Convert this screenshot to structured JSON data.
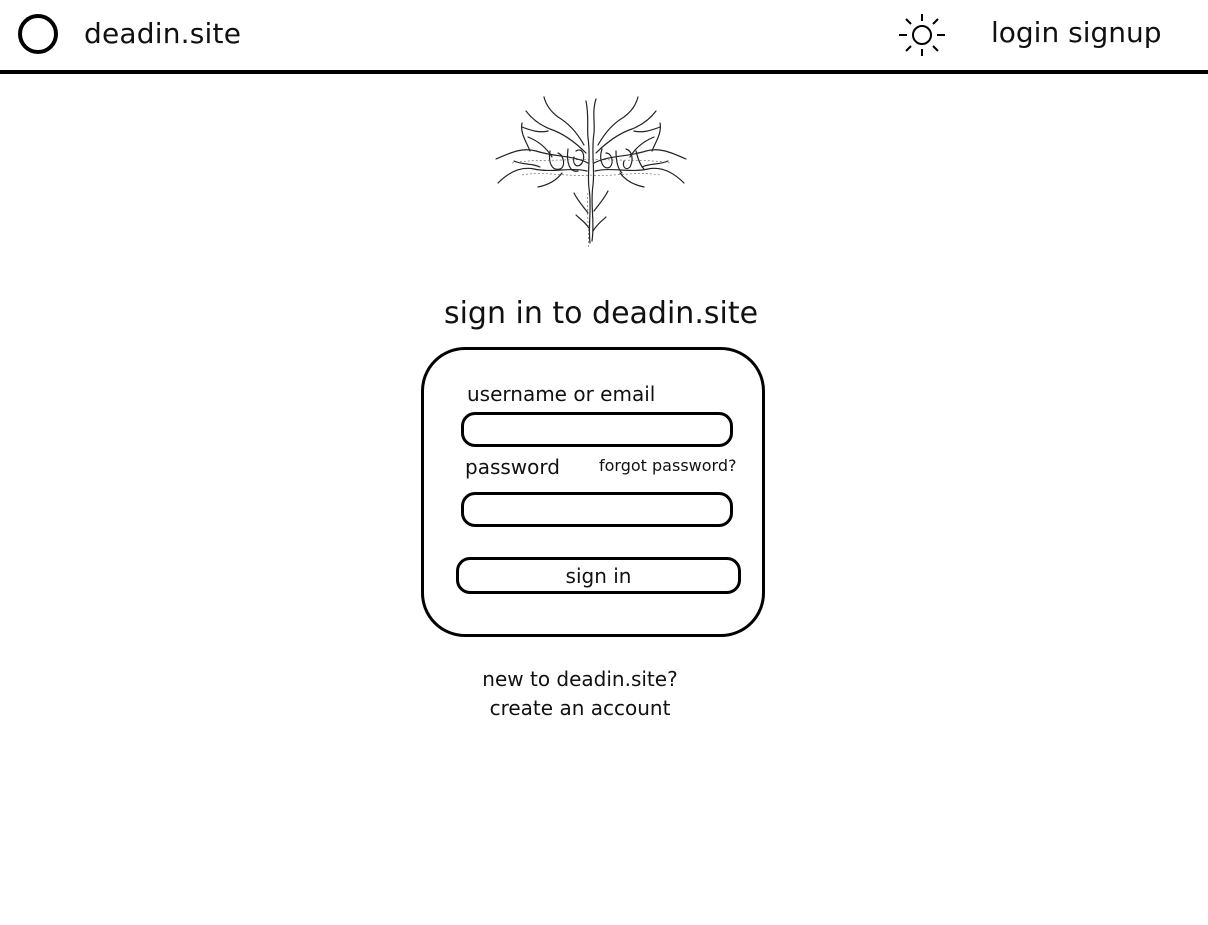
{
  "header": {
    "site_name": "deadin.site",
    "theme_toggle_icon": "sun-icon",
    "login_label": "login",
    "signup_label": "signup"
  },
  "main": {
    "emblem_icon": "deadin-site-tree-logo",
    "heading": "sign in to deadin.site",
    "form": {
      "username_label": "username or email",
      "username_value": "",
      "password_label": "password",
      "password_value": "",
      "forgot_label": "forgot password?",
      "submit_label": "sign in"
    },
    "signup_prompt": "new to deadin.site?",
    "create_account_label": "create an account"
  },
  "colors": {
    "ink": "#000000",
    "background": "#ffffff"
  }
}
